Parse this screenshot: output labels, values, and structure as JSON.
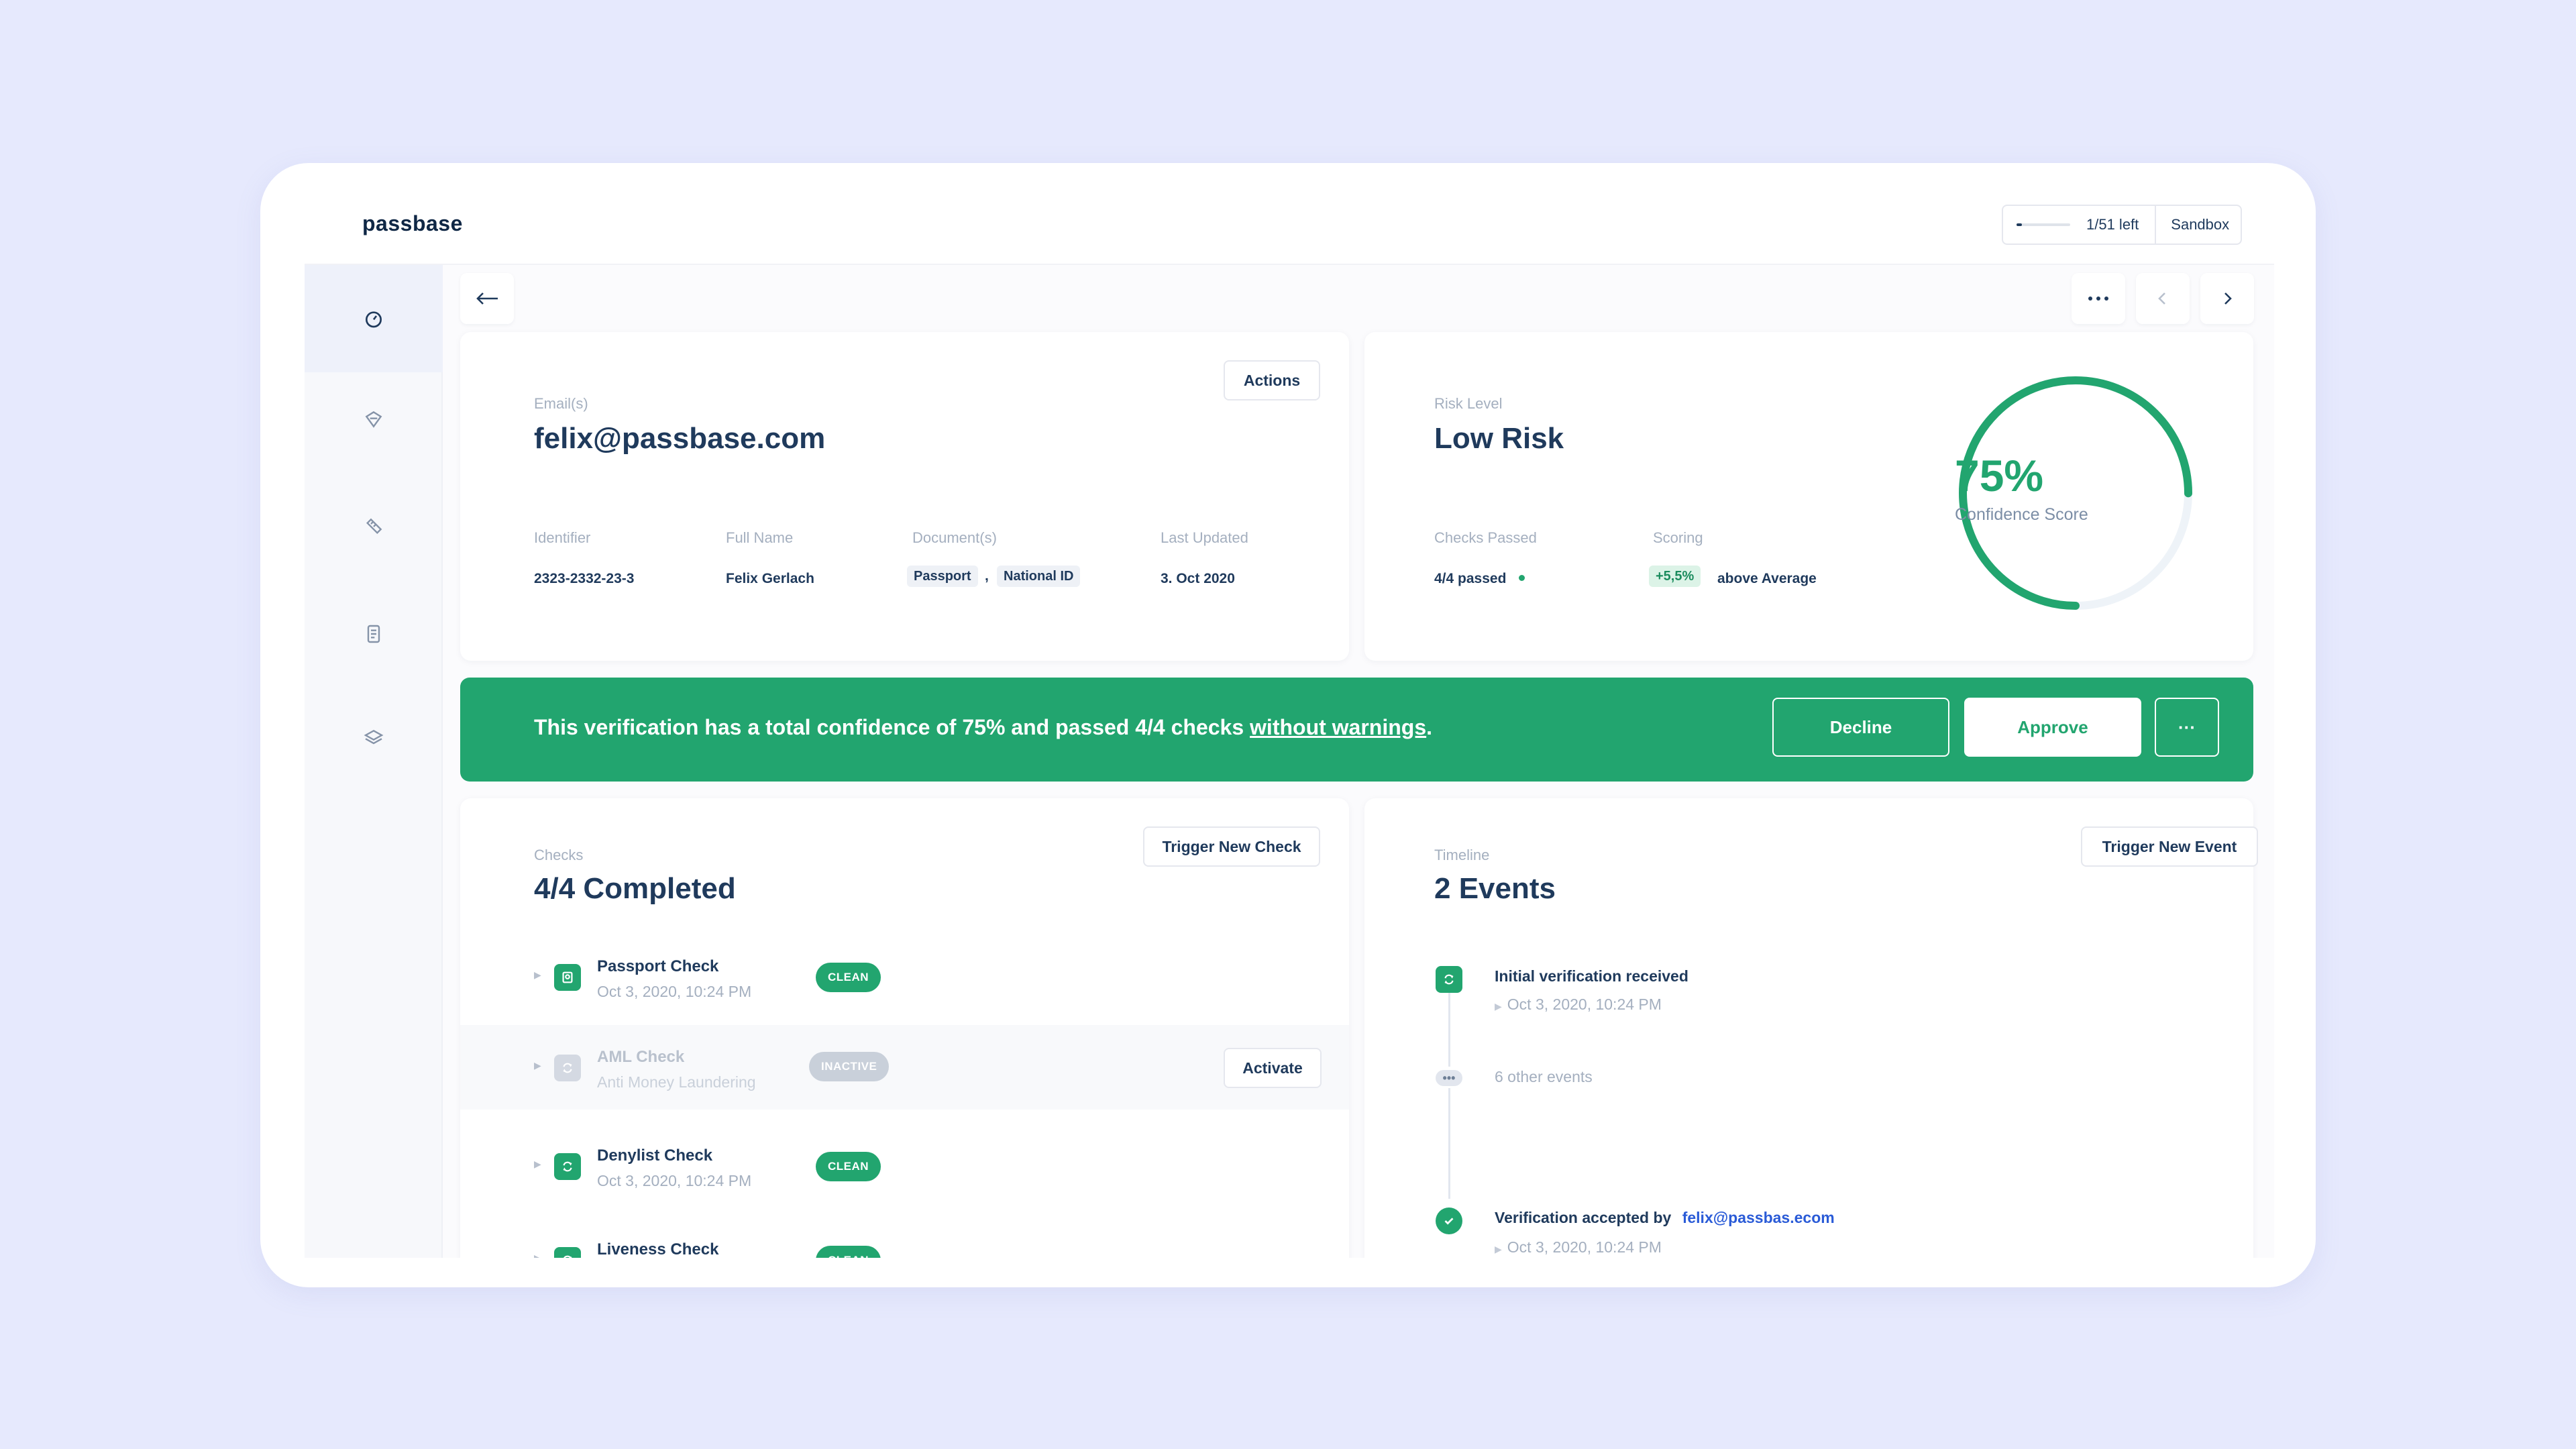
{
  "app": {
    "logo": "passbase"
  },
  "quota": {
    "progress": 0.1,
    "left_text": "1/51 left",
    "environment": "Sandbox"
  },
  "sidebar": {
    "items": [
      {
        "icon": "dashboard-gauge-icon",
        "active": true
      },
      {
        "icon": "shield-scan-icon",
        "active": false
      },
      {
        "icon": "ruler-tag-icon",
        "active": false
      },
      {
        "icon": "document-icon",
        "active": false
      },
      {
        "icon": "layers-icon",
        "active": false
      }
    ]
  },
  "nav": {
    "back": "back-arrow-icon",
    "more": "more-dots-icon",
    "prev": "chevron-left-icon",
    "next": "chevron-right-icon"
  },
  "identity": {
    "actions_label": "Actions",
    "email_label": "Email(s)",
    "email": "felix@passbase.com",
    "identifier_label": "Identifier",
    "identifier": "2323-2332-23-3",
    "fullname_label": "Full Name",
    "fullname": "Felix Gerlach",
    "documents_label": "Document(s)",
    "documents": [
      "Passport",
      "National ID"
    ],
    "documents_sep": ",",
    "updated_label": "Last Updated",
    "updated": "3. Oct 2020"
  },
  "risk": {
    "risk_label": "Risk Level",
    "risk": "Low Risk",
    "checks_label": "Checks Passed",
    "checks": "4/4 passed",
    "scoring_label": "Scoring",
    "scoring_chip": "+5,5%",
    "scoring_text": "above Average",
    "confidence": 0.75,
    "confidence_text": "75%",
    "confidence_label": "Confidence Score",
    "accent": "#22a56f"
  },
  "banner": {
    "text": "This verification has a total confidence of 75% and passed 4/4 checks ",
    "link": "without warnings",
    "end": ".",
    "decline": "Decline",
    "approve": "Approve",
    "more": "···",
    "color": "#22a56f"
  },
  "checks": {
    "label": "Checks",
    "title": "4/4 Completed",
    "trigger": "Trigger New Check",
    "activate": "Activate",
    "items": [
      {
        "name": "Passport Check",
        "date": "Oct 3, 2020, 10:24 PM",
        "status": "CLEAN"
      },
      {
        "name": "AML Check",
        "date": "Anti Money Laundering",
        "status": "INACTIVE"
      },
      {
        "name": "Denylist Check",
        "date": "Oct 3, 2020, 10:24 PM",
        "status": "CLEAN"
      },
      {
        "name": "Liveness Check",
        "date": "",
        "status": "CLEAN"
      }
    ]
  },
  "timeline": {
    "label": "Timeline",
    "title": "2 Events",
    "trigger": "Trigger New Event",
    "event1_title": "Initial verification received",
    "event1_date": "Oct 3, 2020, 10:24 PM",
    "other": "6 other events",
    "event2_title": "Verification accepted by",
    "event2_link": "felix@passbas.ecom",
    "event2_date": "Oct 3, 2020, 10:24 PM"
  }
}
